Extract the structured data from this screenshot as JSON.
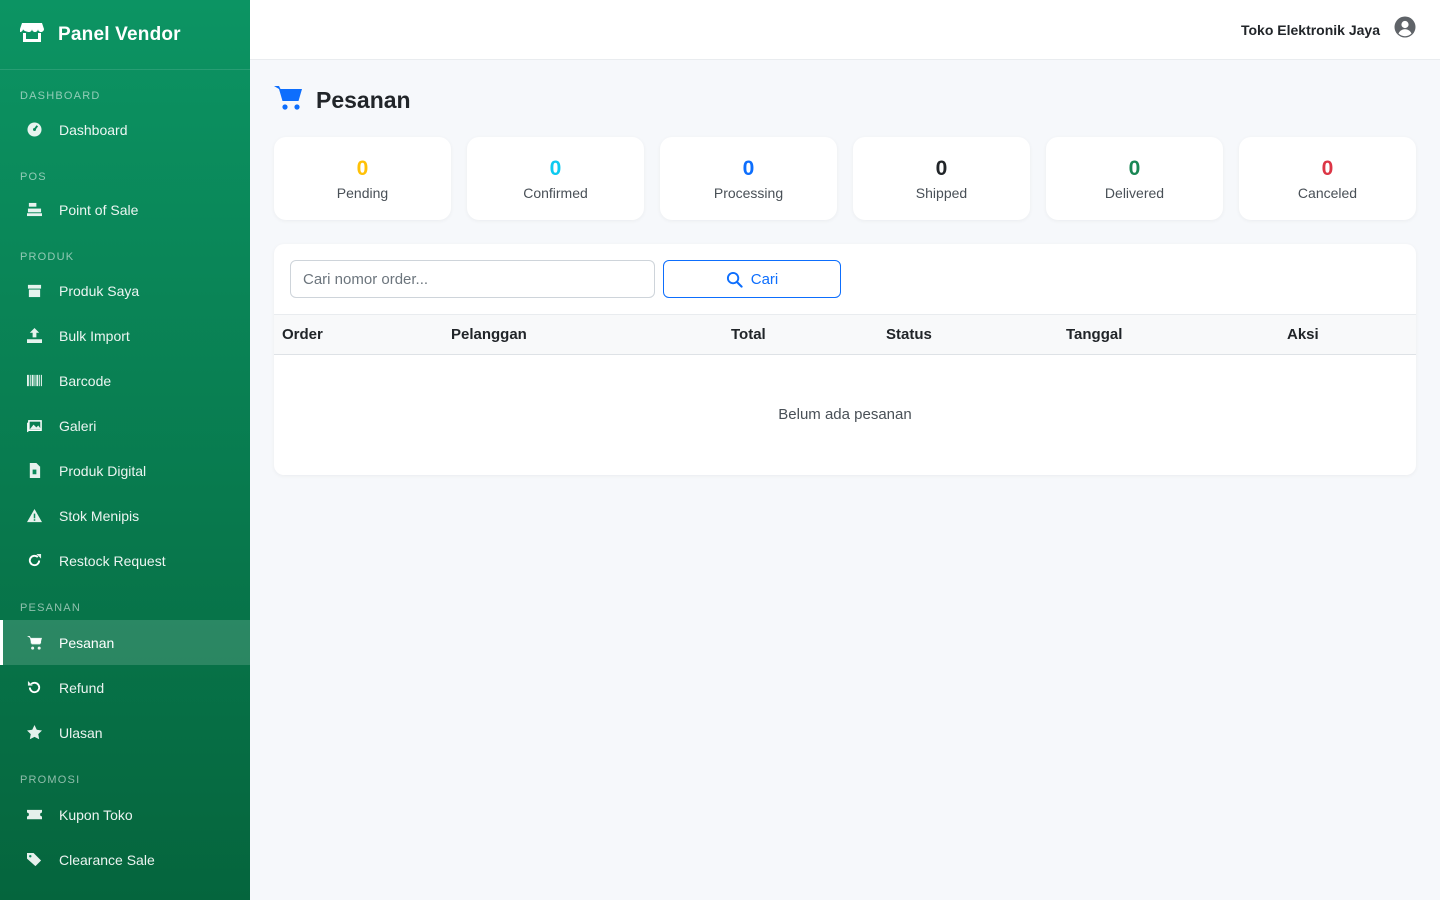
{
  "sidebar": {
    "brand": "Panel Vendor",
    "sections": [
      {
        "label": "DASHBOARD",
        "items": [
          {
            "label": "Dashboard",
            "icon": "gauge-icon"
          }
        ]
      },
      {
        "label": "POS",
        "items": [
          {
            "label": "Point of Sale",
            "icon": "cash-register-icon"
          }
        ]
      },
      {
        "label": "PRODUK",
        "items": [
          {
            "label": "Produk Saya",
            "icon": "box-icon"
          },
          {
            "label": "Bulk Import",
            "icon": "upload-icon"
          },
          {
            "label": "Barcode",
            "icon": "barcode-icon"
          },
          {
            "label": "Galeri",
            "icon": "images-icon"
          },
          {
            "label": "Produk Digital",
            "icon": "file-icon"
          },
          {
            "label": "Stok Menipis",
            "icon": "warning-icon"
          },
          {
            "label": "Restock Request",
            "icon": "refresh-icon"
          }
        ]
      },
      {
        "label": "PESANAN",
        "items": [
          {
            "label": "Pesanan",
            "icon": "cart-icon",
            "active": true
          },
          {
            "label": "Refund",
            "icon": "undo-icon"
          },
          {
            "label": "Ulasan",
            "icon": "star-icon"
          }
        ]
      },
      {
        "label": "PROMOSI",
        "items": [
          {
            "label": "Kupon Toko",
            "icon": "ticket-icon"
          },
          {
            "label": "Clearance Sale",
            "icon": "tags-icon"
          }
        ]
      }
    ]
  },
  "topbar": {
    "store_name": "Toko Elektronik Jaya",
    "user_icon": "user-circle-icon"
  },
  "page": {
    "title": "Pesanan",
    "icon": "cart-icon"
  },
  "stats": [
    {
      "value": "0",
      "label": "Pending",
      "color": "#ffc107"
    },
    {
      "value": "0",
      "label": "Confirmed",
      "color": "#0dcaf0"
    },
    {
      "value": "0",
      "label": "Processing",
      "color": "#0d6efd"
    },
    {
      "value": "0",
      "label": "Shipped",
      "color": "#212529"
    },
    {
      "value": "0",
      "label": "Delivered",
      "color": "#198754"
    },
    {
      "value": "0",
      "label": "Canceled",
      "color": "#dc3545"
    }
  ],
  "search": {
    "placeholder": "Cari nomor order...",
    "button_label": "Cari"
  },
  "table": {
    "columns": [
      "Order",
      "Pelanggan",
      "Total",
      "Status",
      "Tanggal",
      "Aksi"
    ],
    "empty_text": "Belum ada pesanan"
  },
  "colors": {
    "sidebar_top": "#0c9463",
    "sidebar_bottom": "#05653d",
    "accent": "#0d6efd"
  }
}
